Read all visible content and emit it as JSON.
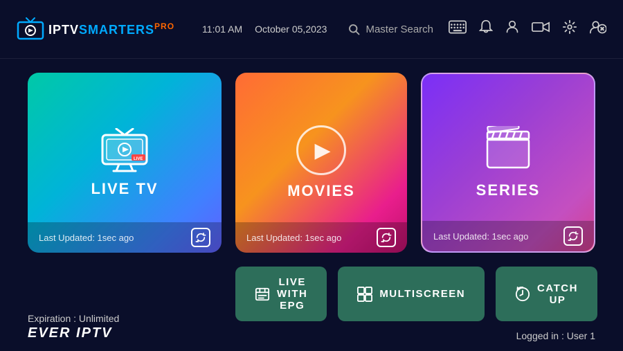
{
  "header": {
    "logo_iptv": "IPTV",
    "logo_smarters": "SMARTERS",
    "logo_pro": "PRO",
    "time": "11:01 AM",
    "date": "October 05,2023",
    "search_label": "Master Search"
  },
  "cards": {
    "live_tv": {
      "title": "LIVE TV",
      "last_updated": "Last Updated: 1sec ago"
    },
    "movies": {
      "title": "MOVIES",
      "last_updated": "Last Updated: 1sec ago"
    },
    "series": {
      "title": "SERIES",
      "last_updated": "Last Updated: 1sec ago"
    }
  },
  "buttons": {
    "live_epg": "LIVE WITH EPG",
    "multiscreen": "MULTISCREEN",
    "catchup": "CATCH UP"
  },
  "footer": {
    "expiration_label": "Expiration : Unlimited",
    "brand": "EVER IPTV",
    "logged_in": "Logged in : User 1"
  }
}
